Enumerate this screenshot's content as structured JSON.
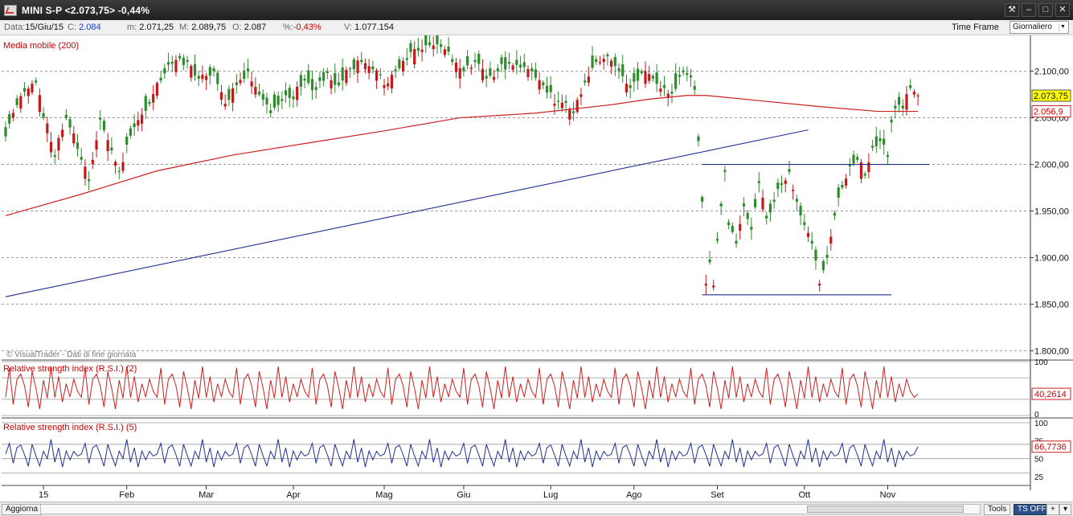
{
  "window": {
    "title": "MINI S-P <2.073,75> -0,44%",
    "buttons": [
      "⚒",
      "–",
      "□",
      "✕"
    ]
  },
  "infobar": {
    "data_label": "Data:",
    "data_value": "15/Giu/15",
    "c_label": "C:",
    "c_value": "2.084",
    "m_label": "m:",
    "m_value": "2.071,25",
    "M_label": "M:",
    "M_value": "2.089,75",
    "o_label": "O:",
    "o_value": "2.087",
    "pct_label": "%:",
    "pct_value": "-0,43%",
    "v_label": "V:",
    "v_value": "1.077.154",
    "timeframe_label": "Time Frame",
    "timeframe_value": "Giornaliero"
  },
  "statusbar": {
    "aggiorna": "Aggiorna",
    "tools": "Tools",
    "ts_off": "TS OFF",
    "plus": "+",
    "menu": "▾"
  },
  "colors": {
    "up": "#2e8b2e",
    "down": "#c21a1a",
    "ma": "#cc1f1f",
    "trendline": "#1f2f8f",
    "rsi2": "#cc1f1f",
    "rsi5": "#1f2f8f",
    "grid": "#9a9a9a",
    "last_price_bg": "#ffff00"
  },
  "chart_data": [
    {
      "type": "candlestick",
      "title": "MINI S-P",
      "indicator_label": "Media mobile (200)",
      "watermark": "© VisualTrader - Dati di fine giornata",
      "y_ticks": [
        "2.100,00",
        "2.050,00",
        "2.000,00",
        "1.950,00",
        "1.900,00",
        "1.850,00",
        "1.800,00"
      ],
      "y_tick_values": [
        2100,
        2050,
        2000,
        1950,
        1900,
        1850,
        1800
      ],
      "ylim": [
        1790,
        2135
      ],
      "x_ticks": [
        "15",
        "Feb",
        "Mar",
        "Apr",
        "Mag",
        "Giu",
        "Lug",
        "Ago",
        "Set",
        "Ott",
        "Nov"
      ],
      "x_tick_index": [
        10,
        32,
        53,
        76,
        100,
        121,
        144,
        166,
        188,
        211,
        233
      ],
      "last_price_label": "2.073,75",
      "ma_price_label": "2.056,9",
      "anchors": [
        [
          0,
          2030,
          2040
        ],
        [
          5,
          2078,
          2082
        ],
        [
          8,
          2088,
          2090
        ],
        [
          10,
          2050,
          2055
        ],
        [
          13,
          2008,
          2010
        ],
        [
          16,
          2050,
          2053
        ],
        [
          20,
          2005,
          2008
        ],
        [
          22,
          1982,
          1984
        ],
        [
          25,
          2048,
          2050
        ],
        [
          28,
          2015,
          2018
        ],
        [
          30,
          1992,
          1993
        ],
        [
          34,
          2040,
          2044
        ],
        [
          38,
          2065,
          2067
        ],
        [
          41,
          2090,
          2093
        ],
        [
          44,
          2108,
          2110
        ],
        [
          48,
          2110,
          2112
        ],
        [
          51,
          2092,
          2095
        ],
        [
          55,
          2100,
          2103
        ],
        [
          58,
          2065,
          2062
        ],
        [
          61,
          2085,
          2088
        ],
        [
          64,
          2100,
          2103
        ],
        [
          67,
          2075,
          2078
        ],
        [
          70,
          2055,
          2058
        ],
        [
          73,
          2068,
          2070
        ],
        [
          76,
          2070,
          2073
        ],
        [
          79,
          2090,
          2092
        ],
        [
          82,
          2080,
          2083
        ],
        [
          85,
          2098,
          2100
        ],
        [
          88,
          2085,
          2088
        ],
        [
          91,
          2102,
          2103
        ],
        [
          94,
          2110,
          2112
        ],
        [
          97,
          2102,
          2105
        ],
        [
          100,
          2085,
          2082
        ],
        [
          103,
          2100,
          2102
        ],
        [
          106,
          2112,
          2114
        ],
        [
          109,
          2122,
          2125
        ],
        [
          112,
          2128,
          2131
        ],
        [
          115,
          2126,
          2129
        ],
        [
          118,
          2110,
          2113
        ],
        [
          121,
          2100,
          2104
        ],
        [
          124,
          2110,
          2112
        ],
        [
          127,
          2092,
          2095
        ],
        [
          130,
          2100,
          2103
        ],
        [
          133,
          2108,
          2110
        ],
        [
          136,
          2104,
          2107
        ],
        [
          139,
          2100,
          2103
        ],
        [
          142,
          2085,
          2088
        ],
        [
          145,
          2065,
          2063
        ],
        [
          148,
          2066,
          2068
        ],
        [
          150,
          2055,
          2057
        ],
        [
          153,
          2088,
          2090
        ],
        [
          156,
          2110,
          2113
        ],
        [
          159,
          2116,
          2118
        ],
        [
          162,
          2100,
          2103
        ],
        [
          165,
          2082,
          2085
        ],
        [
          168,
          2098,
          2100
        ],
        [
          171,
          2092,
          2095
        ],
        [
          174,
          2082,
          2085
        ],
        [
          176,
          2076,
          2078
        ],
        [
          178,
          2094,
          2096
        ],
        [
          180,
          2096,
          2098
        ],
        [
          182,
          2080,
          2084
        ],
        [
          183,
          2025,
          2030
        ],
        [
          184,
          1960,
          1965
        ],
        [
          185,
          1872,
          1870
        ],
        [
          186,
          1895,
          1898
        ],
        [
          187,
          1870,
          1868
        ],
        [
          188,
          1918,
          1920
        ],
        [
          189,
          1955,
          1958
        ],
        [
          190,
          1992,
          1994
        ],
        [
          191,
          1935,
          1938
        ],
        [
          193,
          1915,
          1918
        ],
        [
          195,
          1955,
          1958
        ],
        [
          197,
          1930,
          1933
        ],
        [
          199,
          1980,
          1982
        ],
        [
          201,
          1942,
          1945
        ],
        [
          203,
          1960,
          1962
        ],
        [
          205,
          1978,
          1980
        ],
        [
          207,
          1992,
          1995
        ],
        [
          209,
          1960,
          1963
        ],
        [
          211,
          1935,
          1938
        ],
        [
          213,
          1915,
          1918
        ],
        [
          215,
          1872,
          1870
        ],
        [
          217,
          1900,
          1903
        ],
        [
          219,
          1945,
          1948
        ],
        [
          221,
          1975,
          1978
        ],
        [
          223,
          1998,
          2000
        ],
        [
          225,
          2005,
          2008
        ],
        [
          227,
          1988,
          1990
        ],
        [
          229,
          2018,
          2020
        ],
        [
          231,
          2025,
          2028
        ],
        [
          233,
          2008,
          2010
        ],
        [
          234,
          2045,
          2048
        ],
        [
          235,
          2060,
          2063
        ],
        [
          237,
          2060,
          2063
        ],
        [
          239,
          2082,
          2085
        ],
        [
          240,
          2078,
          2075
        ],
        [
          241,
          2074,
          2073
        ]
      ],
      "ma200": [
        [
          0,
          1945
        ],
        [
          20,
          1968
        ],
        [
          40,
          1993
        ],
        [
          60,
          2010
        ],
        [
          80,
          2023
        ],
        [
          100,
          2036
        ],
        [
          120,
          2050
        ],
        [
          140,
          2055
        ],
        [
          160,
          2064
        ],
        [
          170,
          2070
        ],
        [
          180,
          2074
        ],
        [
          185,
          2074
        ],
        [
          200,
          2068
        ],
        [
          215,
          2062
        ],
        [
          230,
          2057
        ],
        [
          241,
          2056.9
        ]
      ],
      "trendline": [
        [
          0,
          1858
        ],
        [
          212,
          2037
        ]
      ],
      "resistance": [
        [
          184,
          2000
        ],
        [
          244,
          2000
        ]
      ],
      "support": [
        [
          184,
          1860
        ],
        [
          234,
          1860
        ]
      ]
    },
    {
      "type": "line",
      "title": "Relative strength index (R.S.I.) (2)",
      "ticks": [
        "100",
        "0"
      ],
      "ylim": [
        0,
        100
      ],
      "guide_lines": [
        100,
        70,
        30,
        0
      ],
      "last_value_label": "40,2614",
      "pattern": [
        25,
        90,
        10,
        55,
        95,
        40,
        5,
        75,
        60,
        15,
        85,
        35,
        98,
        20,
        65,
        10,
        80,
        45,
        90,
        30
      ],
      "last_value": 40.2614
    },
    {
      "type": "line",
      "title": "Relative strength index (R.S.I.) (5)",
      "ticks": [
        "100",
        "75",
        "50",
        "25"
      ],
      "ylim": [
        15,
        100
      ],
      "guide_lines": [
        100,
        70,
        50,
        30
      ],
      "last_value_label": "66,7736",
      "pattern": [
        55,
        72,
        40,
        60,
        78,
        50,
        35,
        65,
        58,
        42,
        70,
        48,
        82,
        38,
        62,
        30,
        74,
        52,
        68,
        45
      ],
      "last_value": 66.7736
    }
  ]
}
